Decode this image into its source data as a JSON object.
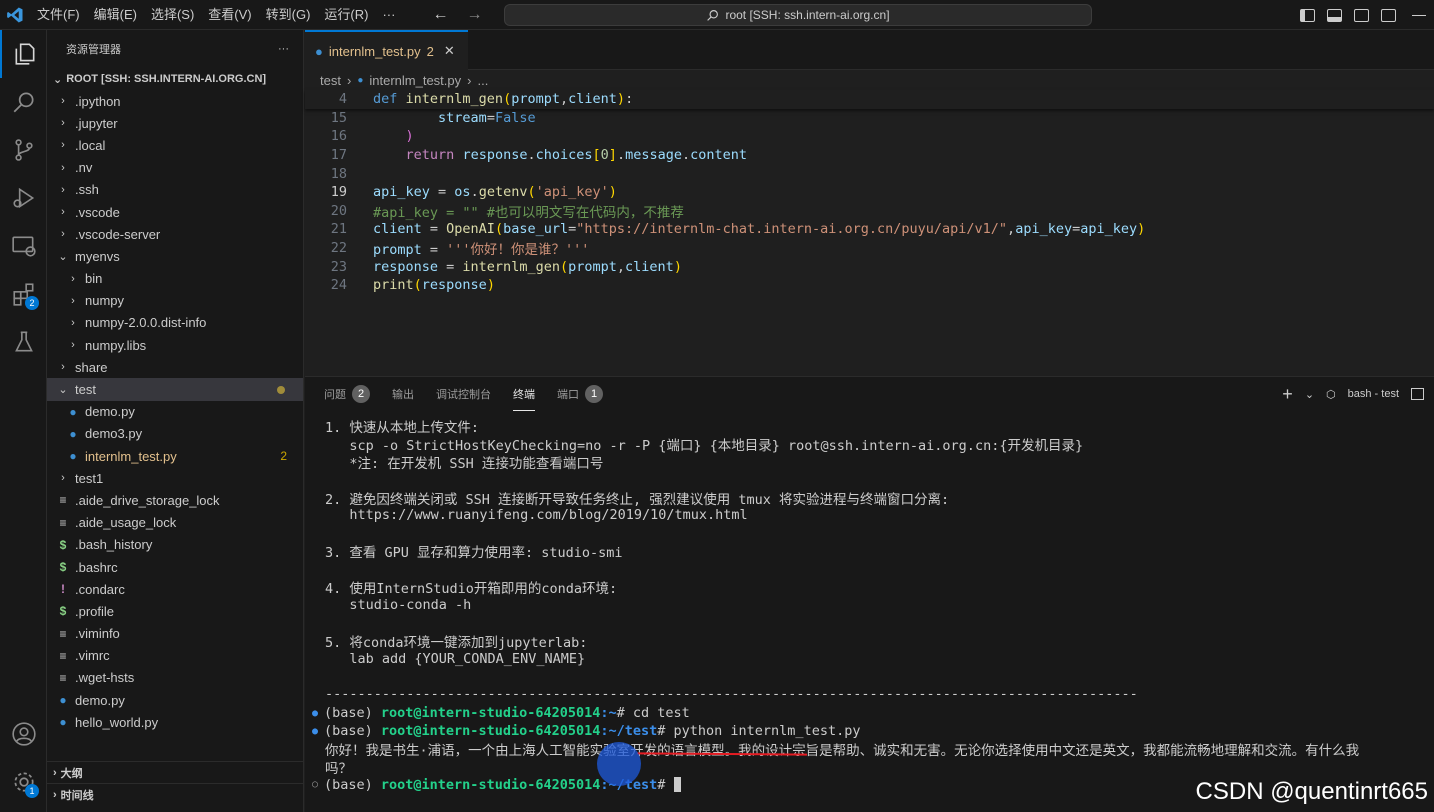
{
  "titlebar": {
    "menu": [
      "文件(F)",
      "编辑(E)",
      "选择(S)",
      "查看(V)",
      "转到(G)",
      "运行(R)",
      "···"
    ],
    "command_center": "root [SSH: ssh.intern-ai.org.cn]"
  },
  "activity": {
    "extensions_badge": "2",
    "accounts_badge": "1"
  },
  "sidebar": {
    "title": "资源管理器",
    "more": "···",
    "root_label": "ROOT [SSH: SSH.INTERN-AI.ORG.CN]",
    "items": [
      {
        "label": ".ipython",
        "type": "folder",
        "depth": 0
      },
      {
        "label": ".jupyter",
        "type": "folder",
        "depth": 0
      },
      {
        "label": ".local",
        "type": "folder",
        "depth": 0
      },
      {
        "label": ".nv",
        "type": "folder",
        "depth": 0
      },
      {
        "label": ".ssh",
        "type": "folder",
        "depth": 0
      },
      {
        "label": ".vscode",
        "type": "folder",
        "depth": 0
      },
      {
        "label": ".vscode-server",
        "type": "folder",
        "depth": 0
      },
      {
        "label": "myenvs",
        "type": "folder-open",
        "depth": 0
      },
      {
        "label": "bin",
        "type": "folder",
        "depth": 1
      },
      {
        "label": "numpy",
        "type": "folder",
        "depth": 1
      },
      {
        "label": "numpy-2.0.0.dist-info",
        "type": "folder",
        "depth": 1
      },
      {
        "label": "numpy.libs",
        "type": "folder",
        "depth": 1
      },
      {
        "label": "share",
        "type": "folder",
        "depth": 0
      },
      {
        "label": "test",
        "type": "folder-open",
        "depth": 0
      },
      {
        "label": "demo.py",
        "type": "py",
        "depth": 1
      },
      {
        "label": "demo3.py",
        "type": "py",
        "depth": 1
      },
      {
        "label": "internlm_test.py",
        "type": "py",
        "depth": 1
      },
      {
        "label": "test1",
        "type": "folder",
        "depth": 0
      },
      {
        "label": ".aide_drive_storage_lock",
        "type": "eq",
        "depth": 0
      },
      {
        "label": ".aide_usage_lock",
        "type": "eq",
        "depth": 0
      },
      {
        "label": ".bash_history",
        "type": "dollar",
        "depth": 0
      },
      {
        "label": ".bashrc",
        "type": "dollar",
        "depth": 0
      },
      {
        "label": ".condarc",
        "type": "bang",
        "depth": 0
      },
      {
        "label": ".profile",
        "type": "dollar",
        "depth": 0
      },
      {
        "label": ".viminfo",
        "type": "eq",
        "depth": 0
      },
      {
        "label": ".vimrc",
        "type": "eq",
        "depth": 0
      },
      {
        "label": ".wget-hsts",
        "type": "eq",
        "depth": 0
      },
      {
        "label": "demo.py",
        "type": "py",
        "depth": 0
      },
      {
        "label": "hello_world.py",
        "type": "py",
        "depth": 0
      }
    ],
    "problem_count": "2",
    "outline": "大纲",
    "timeline": "时间线"
  },
  "editor": {
    "tab_label": "internlm_test.py",
    "tab_problems": "2",
    "breadcrumb_folder": "test",
    "breadcrumb_file": "internlm_test.py",
    "breadcrumb_more": "..."
  },
  "code_lines": [
    {
      "n": "4",
      "t": "def internlm_gen(prompt,client):"
    },
    {
      "n": "15",
      "t": "        stream=False"
    },
    {
      "n": "16",
      "t": "    )"
    },
    {
      "n": "17",
      "t": "    return response.choices[0].message.content"
    },
    {
      "n": "18",
      "t": ""
    },
    {
      "n": "19",
      "t": "api_key = os.getenv('api_key')"
    },
    {
      "n": "20",
      "t": "#api_key = \"\" #也可以明文写在代码内，不推荐"
    },
    {
      "n": "21",
      "t": "client = OpenAI(base_url=\"https://internlm-chat.intern-ai.org.cn/puyu/api/v1/\",api_key=api_key)"
    },
    {
      "n": "22",
      "t": "prompt = '''你好！你是谁？'''"
    },
    {
      "n": "23",
      "t": "response = internlm_gen(prompt,client)"
    },
    {
      "n": "24",
      "t": "print(response)"
    }
  ],
  "panel": {
    "tabs": [
      "问题",
      "输出",
      "调试控制台",
      "终端",
      "端口"
    ],
    "problems_count": "2",
    "ports_count": "1",
    "terminal_name": "bash - test"
  },
  "terminal": {
    "lines": [
      "1. 快速从本地上传文件:",
      "   scp -o StrictHostKeyChecking=no -r -P {端口} {本地目录} root@ssh.intern-ai.org.cn:{开发机目录}",
      "   *注: 在开发机 SSH 连接功能查看端口号",
      "",
      "2. 避免因终端关闭或 SSH 连接断开导致任务终止, 强烈建议使用 tmux 将实验进程与终端窗口分离:",
      "   https://www.ruanyifeng.com/blog/2019/10/tmux.html",
      "",
      "3. 查看 GPU 显存和算力使用率: studio-smi",
      "",
      "4. 使用InternStudio开箱即用的conda环境:",
      "   studio-conda -h",
      "",
      "5. 将conda环境一键添加到jupyterlab:",
      "   lab add {YOUR_CONDA_ENV_NAME}",
      "",
      "----------------------------------------------------------------------------------------------------"
    ],
    "cmd1_base": "(base) ",
    "cmd1_user": "root@intern-studio-64205014",
    "cmd1_path": ":~",
    "cmd1_cmd": "# cd test",
    "cmd2_base": "(base) ",
    "cmd2_user": "root@intern-studio-64205014",
    "cmd2_path": ":~/test",
    "cmd2_cmd": "# python internlm_test.py",
    "output1": "你好！我是书生·浦语，一个由上海人工智能实验室开发的语言模型。我的设计宗旨是帮助、诚实和无害。无论你选择使用中文还是英文，我都能流畅地理解和交流。有什么我",
    "output2": "吗？",
    "cmd3_base": "(base) ",
    "cmd3_user": "root@intern-studio-64205014",
    "cmd3_path": ":~/test",
    "cmd3_cmd": "# "
  },
  "watermark": "CSDN @quentinrt665",
  "colors": {
    "accent": "#0078d4",
    "modified": "#e2c08d",
    "prompt_user": "#23d18b",
    "prompt_path": "#3b8eea"
  }
}
